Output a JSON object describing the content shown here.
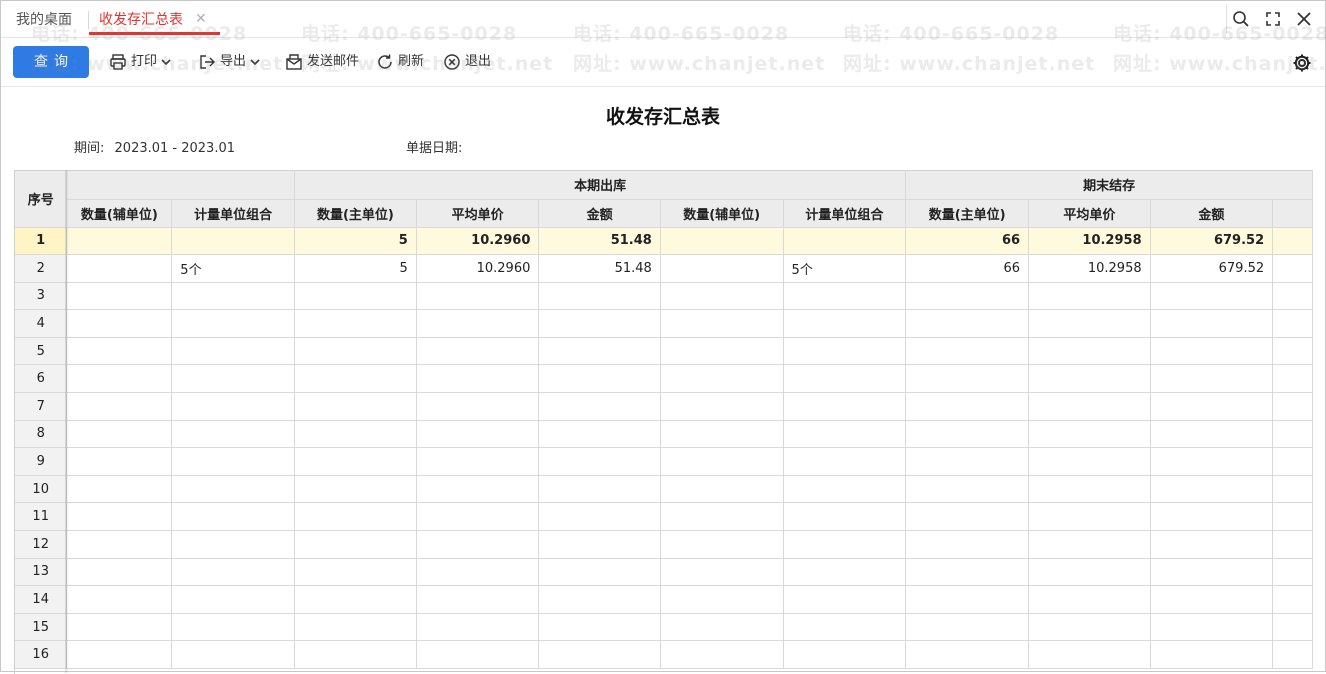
{
  "tabs": {
    "home": "我的桌面",
    "active": "收发存汇总表",
    "close_glyph": "✕"
  },
  "toolbar": {
    "query": "查询",
    "print": "打印",
    "export": "导出",
    "send_mail": "发送邮件",
    "refresh": "刷新",
    "exit": "退出"
  },
  "report": {
    "title": "收发存汇总表",
    "period_label": "期间:",
    "period_value": "2023.01 - 2023.01",
    "doc_date_label": "单据日期:"
  },
  "table": {
    "group_headers": {
      "out": "本期出库",
      "end": "期末结存"
    },
    "columns": {
      "index": "序号",
      "qty_aux_1": "数量(辅单位)",
      "unit_combo_1": "计量单位组合",
      "qty_main_1": "数量(主单位)",
      "avg_price_1": "平均单价",
      "amount_1": "金额",
      "qty_aux_2": "数量(辅单位)",
      "unit_combo_2": "计量单位组合",
      "qty_main_2": "数量(主单位)",
      "avg_price_2": "平均单价",
      "amount_2": "金额"
    },
    "rows": [
      {
        "idx": "1",
        "qty_aux_1": "",
        "unit_combo_1": "",
        "qty_main_1": "5",
        "avg_price_1": "10.2960",
        "amount_1": "51.48",
        "qty_aux_2": "",
        "unit_combo_2": "",
        "qty_main_2": "66",
        "avg_price_2": "10.2958",
        "amount_2": "679.52"
      },
      {
        "idx": "2",
        "qty_aux_1": "",
        "unit_combo_1": "5个",
        "qty_main_1": "5",
        "avg_price_1": "10.2960",
        "amount_1": "51.48",
        "qty_aux_2": "",
        "unit_combo_2": "5个",
        "qty_main_2": "66",
        "avg_price_2": "10.2958",
        "amount_2": "679.52"
      },
      {
        "idx": "3"
      },
      {
        "idx": "4"
      },
      {
        "idx": "5"
      },
      {
        "idx": "6"
      },
      {
        "idx": "7"
      },
      {
        "idx": "8"
      },
      {
        "idx": "9"
      },
      {
        "idx": "10"
      },
      {
        "idx": "11"
      },
      {
        "idx": "12"
      },
      {
        "idx": "13"
      },
      {
        "idx": "14"
      },
      {
        "idx": "15"
      },
      {
        "idx": "16"
      }
    ],
    "selected_row": "1"
  },
  "watermark": {
    "phone": "电话: 400-665-0028",
    "site": "网址: www.chanjet.net"
  },
  "colors": {
    "accent": "#2f7be5",
    "active_tab": "#e5322d",
    "selected_row": "#fff9dd"
  }
}
